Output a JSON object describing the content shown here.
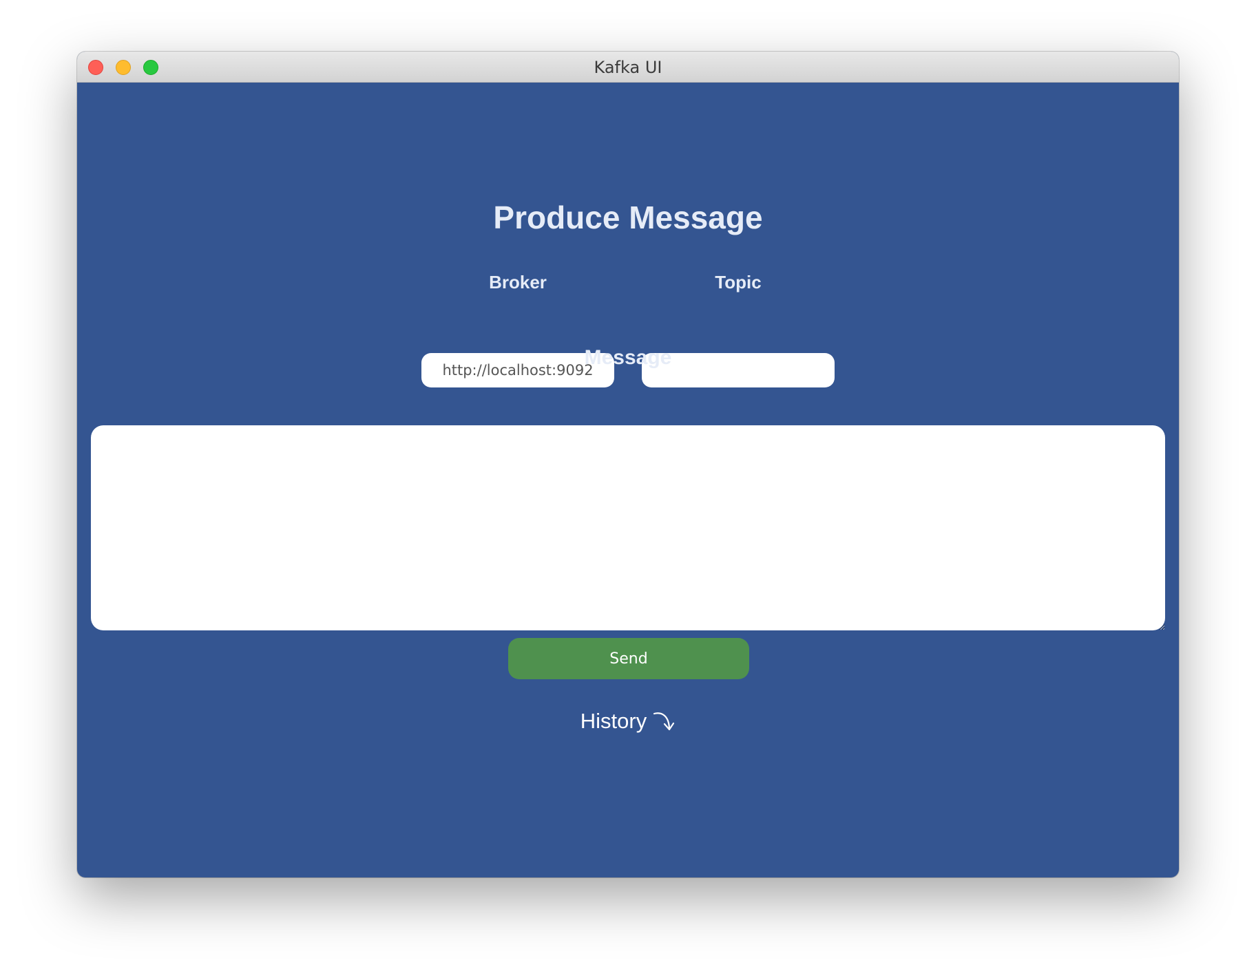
{
  "window": {
    "title": "Kafka UI"
  },
  "form": {
    "heading": "Produce Message",
    "broker_label": "Broker",
    "broker_value": "http://localhost:9092",
    "topic_label": "Topic",
    "topic_value": "",
    "message_label": "Message",
    "message_value": "",
    "send_label": "Send"
  },
  "history": {
    "label": "History",
    "icon": "curved-arrow-down-icon"
  },
  "colors": {
    "background": "#345591",
    "send_button": "#4f914e",
    "text": "#e6ecf7"
  }
}
